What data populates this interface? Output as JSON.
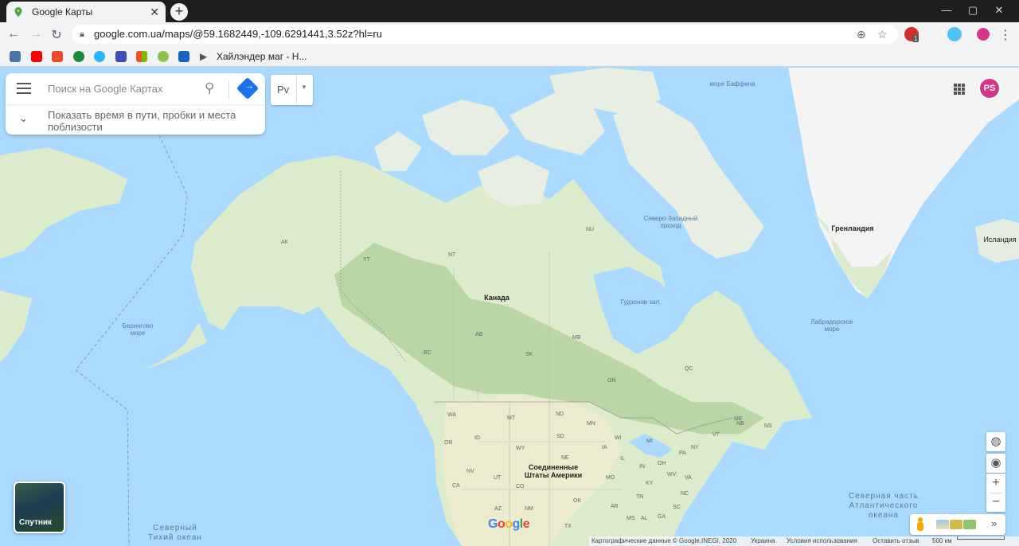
{
  "browser": {
    "tab_title": "Google Карты",
    "url": "google.com.ua/maps/@59.1682449,-109.6291441,3.52z?hl=ru",
    "bookmark_label": "Хайлэндер маг - Н...",
    "ext_badge": "1"
  },
  "search": {
    "placeholder": "Поиск на Google Картах",
    "travel_text": "Показать время в пути, пробки и места поблизости",
    "lang_label": "Рv"
  },
  "profile": {
    "initials": "PS"
  },
  "map": {
    "countries": {
      "canada": "Канада",
      "usa": "Соединенные Штаты Америки",
      "greenland": "Гренландия",
      "iceland": "Исландия"
    },
    "seas": {
      "baffin": "море Баффина",
      "northwest": "Северо-Западный проход",
      "hudson": "Гудзонов зал.",
      "labrador": "Лабрадорское море",
      "bering": "Берингово море",
      "pacific": "Северный Тихий океан",
      "atlantic": "Северная часть Атлантического океана"
    },
    "regions": [
      "AK",
      "YT",
      "NT",
      "NU",
      "BC",
      "AB",
      "SK",
      "MB",
      "ON",
      "QC",
      "NB",
      "NS",
      "WA",
      "OR",
      "MT",
      "ND",
      "MN",
      "SD",
      "ID",
      "WY",
      "NE",
      "NV",
      "UT",
      "CO",
      "CA",
      "AZ",
      "NM",
      "OK",
      "TX",
      "IA",
      "WI",
      "MI",
      "IL",
      "IN",
      "OH",
      "PA",
      "NY",
      "VT",
      "ME",
      "MO",
      "KY",
      "TN",
      "VA",
      "NC",
      "SC",
      "AR",
      "MS",
      "AL",
      "GA",
      "WV"
    ]
  },
  "controls": {
    "satellite_label": "Спутник",
    "zoom_in": "+",
    "zoom_out": "−",
    "layers_expand": "»"
  },
  "footer": {
    "data_credit": "Картографические данные © Google,INEGI, 2020",
    "region": "Украина",
    "terms": "Условия использования",
    "feedback": "Оставить отзыв",
    "scale": "500 км"
  },
  "colors": {
    "water": "#aadaff",
    "land": "#dcebcc",
    "forest": "#b9d6a4",
    "ice": "#f4f4f4",
    "accent": "#1a73e8",
    "avatar": "#d6358a"
  }
}
